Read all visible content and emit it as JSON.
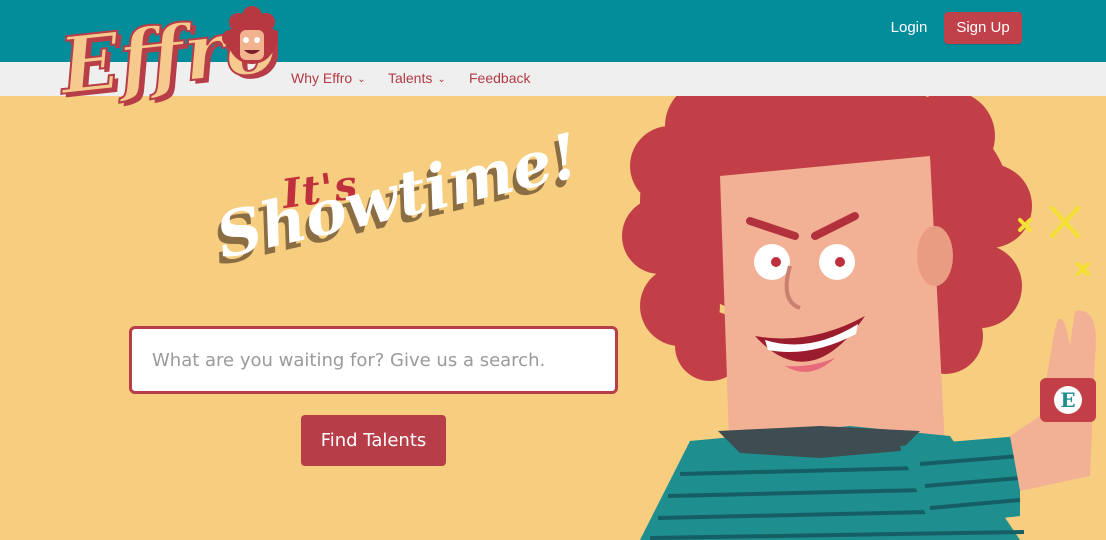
{
  "brand": {
    "logo_text": "Effro"
  },
  "header": {
    "login_label": "Login",
    "signup_label": "Sign Up"
  },
  "nav": {
    "items": [
      {
        "label": "Why Effro",
        "has_dropdown": true
      },
      {
        "label": "Talents",
        "has_dropdown": true
      },
      {
        "label": "Feedback",
        "has_dropdown": false
      }
    ]
  },
  "hero": {
    "headline_small": "It's",
    "headline_large": "Showtime!",
    "search_placeholder": "What are you waiting for? Give us a search.",
    "search_value": "",
    "cta_label": "Find Talents",
    "wristband_letter": "E"
  },
  "colors": {
    "topbar": "#038d9b",
    "accent": "#b73d48",
    "hero_bg": "#f7cd80",
    "subnav_bg": "#efefef",
    "hair": "#c23f47",
    "shirt": "#1e8e8e"
  },
  "icons": {
    "nav_dropdown": "chevron-down-icon"
  }
}
